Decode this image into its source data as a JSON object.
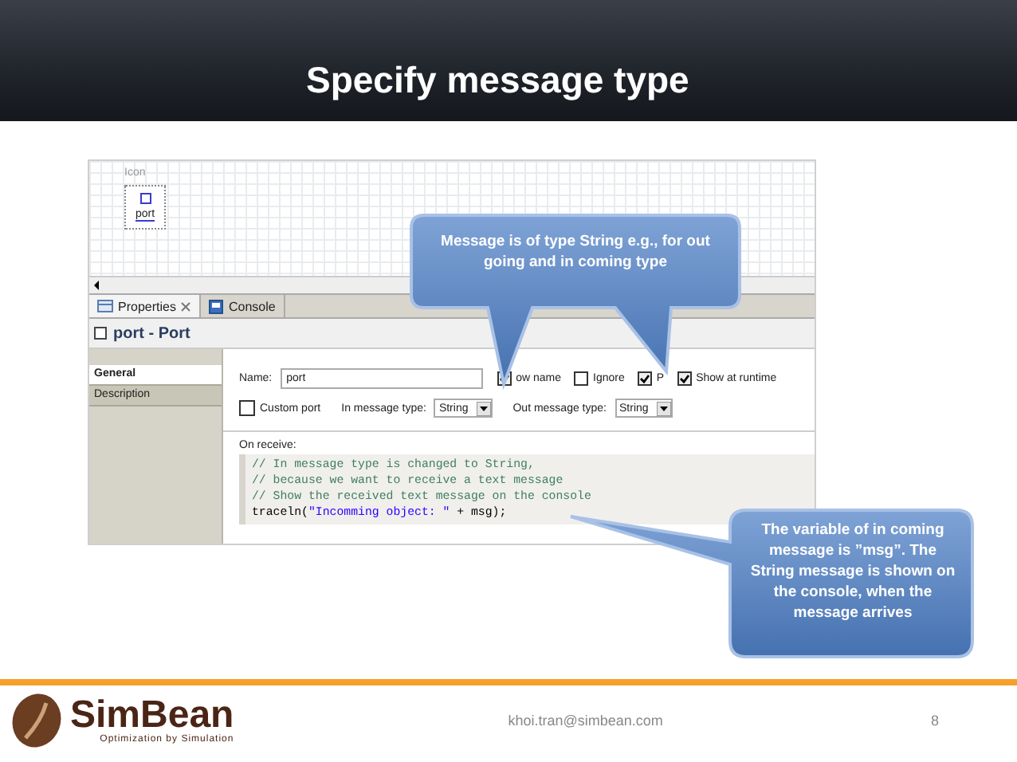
{
  "slide": {
    "title": "Specify message type"
  },
  "editor": {
    "canvas": {
      "label": "Icon",
      "port_label": "port"
    },
    "tabs": [
      {
        "label": "Properties",
        "selected": true
      },
      {
        "label": "Console",
        "selected": false
      }
    ],
    "header": "port - Port",
    "sidebar": [
      {
        "label": "General",
        "selected": true
      },
      {
        "label": "Description",
        "selected": false
      }
    ],
    "name": {
      "label": "Name:",
      "value": "port"
    },
    "flags": [
      {
        "label": "ow name",
        "checked": true
      },
      {
        "label": "Ignore",
        "checked": false
      },
      {
        "label": "P",
        "checked": true
      },
      {
        "label": "Show at runtime",
        "checked": true
      }
    ],
    "custom_port": {
      "label": "Custom port",
      "checked": false
    },
    "type_fields": [
      {
        "label": "In message type:",
        "value": "String"
      },
      {
        "label": "Out message type:",
        "value": "String"
      }
    ],
    "on_receive": {
      "label": "On receive:",
      "lines": [
        [
          {
            "kind": "comment",
            "text": "// In message type is changed to String,"
          }
        ],
        [
          {
            "kind": "comment",
            "text": "// because we want to receive a text message"
          }
        ],
        [
          {
            "kind": "comment",
            "text": "// Show the received text message on the console"
          }
        ],
        [
          {
            "kind": "code",
            "text": "traceln("
          },
          {
            "kind": "string",
            "text": "\"Incomming object: \""
          },
          {
            "kind": "code",
            "text": " + msg);"
          }
        ]
      ]
    }
  },
  "callouts": [
    {
      "text": "Message is of type String e.g., for out going and in coming type"
    },
    {
      "text": "The variable of in coming message is ”msg”.  The String message is shown on the console, when the message arrives"
    }
  ],
  "footer": {
    "brand": "SimBean",
    "tagline": "Optimization by Simulation",
    "email": "khoi.tran@simbean.com",
    "page": "8"
  }
}
